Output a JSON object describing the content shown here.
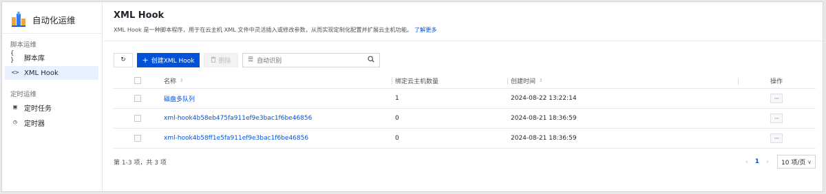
{
  "sidebar": {
    "brand": {
      "title": "自动化运维",
      "icon": "app-logo-icon"
    },
    "groups": [
      {
        "title": "脚本运维",
        "items": [
          {
            "icon_text": "{ }",
            "icon": "braces-icon",
            "label": "脚本库",
            "active": false
          },
          {
            "icon_text": "<>",
            "icon": "code-icon",
            "label": "XML Hook",
            "active": true
          }
        ]
      },
      {
        "title": "定时运维",
        "items": [
          {
            "icon_text": "▣",
            "icon": "clipboard-icon",
            "label": "定时任务",
            "active": false
          },
          {
            "icon_text": "◷",
            "icon": "timer-icon",
            "label": "定时器",
            "active": false
          }
        ]
      }
    ]
  },
  "header": {
    "title": "XML Hook",
    "description": "XML Hook 是一种脚本程序，用于在云主机 XML 文件中灵活插入或修改参数，从而实现定制化配置并扩展云主机功能。",
    "learn_more": "了解更多"
  },
  "toolbar": {
    "refresh_icon": "↻",
    "create_label": "创建XML Hook",
    "delete_label": "删除",
    "search_placeholder": "自动识别"
  },
  "table": {
    "columns": {
      "name": "名称",
      "count": "绑定云主机数量",
      "created": "创建时间",
      "actions": "操作"
    },
    "rows": [
      {
        "name": "磁盘多队列",
        "count": "1",
        "created": "2024-08-22 13:22:14"
      },
      {
        "name": "xml-hook4b58eb475fa911ef9e3bac1f6be46856",
        "count": "0",
        "created": "2024-08-21 18:36:59"
      },
      {
        "name": "xml-hook4b58ff1e5fa911ef9e3bac1f6be46856",
        "count": "0",
        "created": "2024-08-21 18:36:59"
      }
    ],
    "more_icon": "···"
  },
  "footer": {
    "total": "第 1-3 项，共 3 项",
    "current_page": "1",
    "page_size": "10 项/页"
  },
  "colors": {
    "primary": "#0052d9",
    "active_nav_bg": "#e8f1ff"
  }
}
